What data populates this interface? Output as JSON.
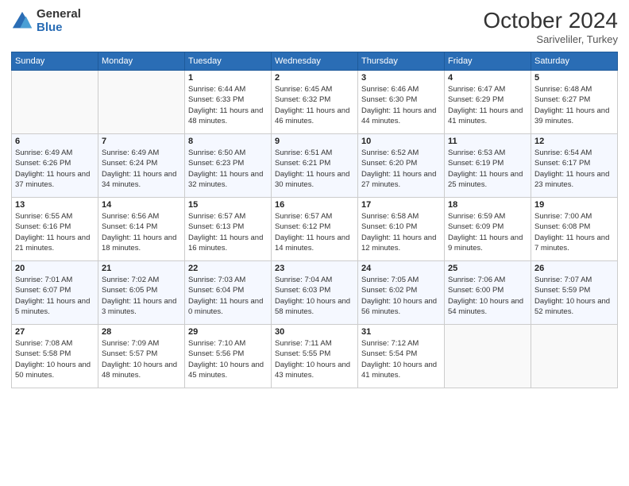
{
  "header": {
    "logo_general": "General",
    "logo_blue": "Blue",
    "month_year": "October 2024",
    "location": "Sariveliler, Turkey"
  },
  "days_of_week": [
    "Sunday",
    "Monday",
    "Tuesday",
    "Wednesday",
    "Thursday",
    "Friday",
    "Saturday"
  ],
  "weeks": [
    [
      {
        "day": "",
        "sunrise": "",
        "sunset": "",
        "daylight": ""
      },
      {
        "day": "",
        "sunrise": "",
        "sunset": "",
        "daylight": ""
      },
      {
        "day": "1",
        "sunrise": "Sunrise: 6:44 AM",
        "sunset": "Sunset: 6:33 PM",
        "daylight": "Daylight: 11 hours and 48 minutes."
      },
      {
        "day": "2",
        "sunrise": "Sunrise: 6:45 AM",
        "sunset": "Sunset: 6:32 PM",
        "daylight": "Daylight: 11 hours and 46 minutes."
      },
      {
        "day": "3",
        "sunrise": "Sunrise: 6:46 AM",
        "sunset": "Sunset: 6:30 PM",
        "daylight": "Daylight: 11 hours and 44 minutes."
      },
      {
        "day": "4",
        "sunrise": "Sunrise: 6:47 AM",
        "sunset": "Sunset: 6:29 PM",
        "daylight": "Daylight: 11 hours and 41 minutes."
      },
      {
        "day": "5",
        "sunrise": "Sunrise: 6:48 AM",
        "sunset": "Sunset: 6:27 PM",
        "daylight": "Daylight: 11 hours and 39 minutes."
      }
    ],
    [
      {
        "day": "6",
        "sunrise": "Sunrise: 6:49 AM",
        "sunset": "Sunset: 6:26 PM",
        "daylight": "Daylight: 11 hours and 37 minutes."
      },
      {
        "day": "7",
        "sunrise": "Sunrise: 6:49 AM",
        "sunset": "Sunset: 6:24 PM",
        "daylight": "Daylight: 11 hours and 34 minutes."
      },
      {
        "day": "8",
        "sunrise": "Sunrise: 6:50 AM",
        "sunset": "Sunset: 6:23 PM",
        "daylight": "Daylight: 11 hours and 32 minutes."
      },
      {
        "day": "9",
        "sunrise": "Sunrise: 6:51 AM",
        "sunset": "Sunset: 6:21 PM",
        "daylight": "Daylight: 11 hours and 30 minutes."
      },
      {
        "day": "10",
        "sunrise": "Sunrise: 6:52 AM",
        "sunset": "Sunset: 6:20 PM",
        "daylight": "Daylight: 11 hours and 27 minutes."
      },
      {
        "day": "11",
        "sunrise": "Sunrise: 6:53 AM",
        "sunset": "Sunset: 6:19 PM",
        "daylight": "Daylight: 11 hours and 25 minutes."
      },
      {
        "day": "12",
        "sunrise": "Sunrise: 6:54 AM",
        "sunset": "Sunset: 6:17 PM",
        "daylight": "Daylight: 11 hours and 23 minutes."
      }
    ],
    [
      {
        "day": "13",
        "sunrise": "Sunrise: 6:55 AM",
        "sunset": "Sunset: 6:16 PM",
        "daylight": "Daylight: 11 hours and 21 minutes."
      },
      {
        "day": "14",
        "sunrise": "Sunrise: 6:56 AM",
        "sunset": "Sunset: 6:14 PM",
        "daylight": "Daylight: 11 hours and 18 minutes."
      },
      {
        "day": "15",
        "sunrise": "Sunrise: 6:57 AM",
        "sunset": "Sunset: 6:13 PM",
        "daylight": "Daylight: 11 hours and 16 minutes."
      },
      {
        "day": "16",
        "sunrise": "Sunrise: 6:57 AM",
        "sunset": "Sunset: 6:12 PM",
        "daylight": "Daylight: 11 hours and 14 minutes."
      },
      {
        "day": "17",
        "sunrise": "Sunrise: 6:58 AM",
        "sunset": "Sunset: 6:10 PM",
        "daylight": "Daylight: 11 hours and 12 minutes."
      },
      {
        "day": "18",
        "sunrise": "Sunrise: 6:59 AM",
        "sunset": "Sunset: 6:09 PM",
        "daylight": "Daylight: 11 hours and 9 minutes."
      },
      {
        "day": "19",
        "sunrise": "Sunrise: 7:00 AM",
        "sunset": "Sunset: 6:08 PM",
        "daylight": "Daylight: 11 hours and 7 minutes."
      }
    ],
    [
      {
        "day": "20",
        "sunrise": "Sunrise: 7:01 AM",
        "sunset": "Sunset: 6:07 PM",
        "daylight": "Daylight: 11 hours and 5 minutes."
      },
      {
        "day": "21",
        "sunrise": "Sunrise: 7:02 AM",
        "sunset": "Sunset: 6:05 PM",
        "daylight": "Daylight: 11 hours and 3 minutes."
      },
      {
        "day": "22",
        "sunrise": "Sunrise: 7:03 AM",
        "sunset": "Sunset: 6:04 PM",
        "daylight": "Daylight: 11 hours and 0 minutes."
      },
      {
        "day": "23",
        "sunrise": "Sunrise: 7:04 AM",
        "sunset": "Sunset: 6:03 PM",
        "daylight": "Daylight: 10 hours and 58 minutes."
      },
      {
        "day": "24",
        "sunrise": "Sunrise: 7:05 AM",
        "sunset": "Sunset: 6:02 PM",
        "daylight": "Daylight: 10 hours and 56 minutes."
      },
      {
        "day": "25",
        "sunrise": "Sunrise: 7:06 AM",
        "sunset": "Sunset: 6:00 PM",
        "daylight": "Daylight: 10 hours and 54 minutes."
      },
      {
        "day": "26",
        "sunrise": "Sunrise: 7:07 AM",
        "sunset": "Sunset: 5:59 PM",
        "daylight": "Daylight: 10 hours and 52 minutes."
      }
    ],
    [
      {
        "day": "27",
        "sunrise": "Sunrise: 7:08 AM",
        "sunset": "Sunset: 5:58 PM",
        "daylight": "Daylight: 10 hours and 50 minutes."
      },
      {
        "day": "28",
        "sunrise": "Sunrise: 7:09 AM",
        "sunset": "Sunset: 5:57 PM",
        "daylight": "Daylight: 10 hours and 48 minutes."
      },
      {
        "day": "29",
        "sunrise": "Sunrise: 7:10 AM",
        "sunset": "Sunset: 5:56 PM",
        "daylight": "Daylight: 10 hours and 45 minutes."
      },
      {
        "day": "30",
        "sunrise": "Sunrise: 7:11 AM",
        "sunset": "Sunset: 5:55 PM",
        "daylight": "Daylight: 10 hours and 43 minutes."
      },
      {
        "day": "31",
        "sunrise": "Sunrise: 7:12 AM",
        "sunset": "Sunset: 5:54 PM",
        "daylight": "Daylight: 10 hours and 41 minutes."
      },
      {
        "day": "",
        "sunrise": "",
        "sunset": "",
        "daylight": ""
      },
      {
        "day": "",
        "sunrise": "",
        "sunset": "",
        "daylight": ""
      }
    ]
  ]
}
